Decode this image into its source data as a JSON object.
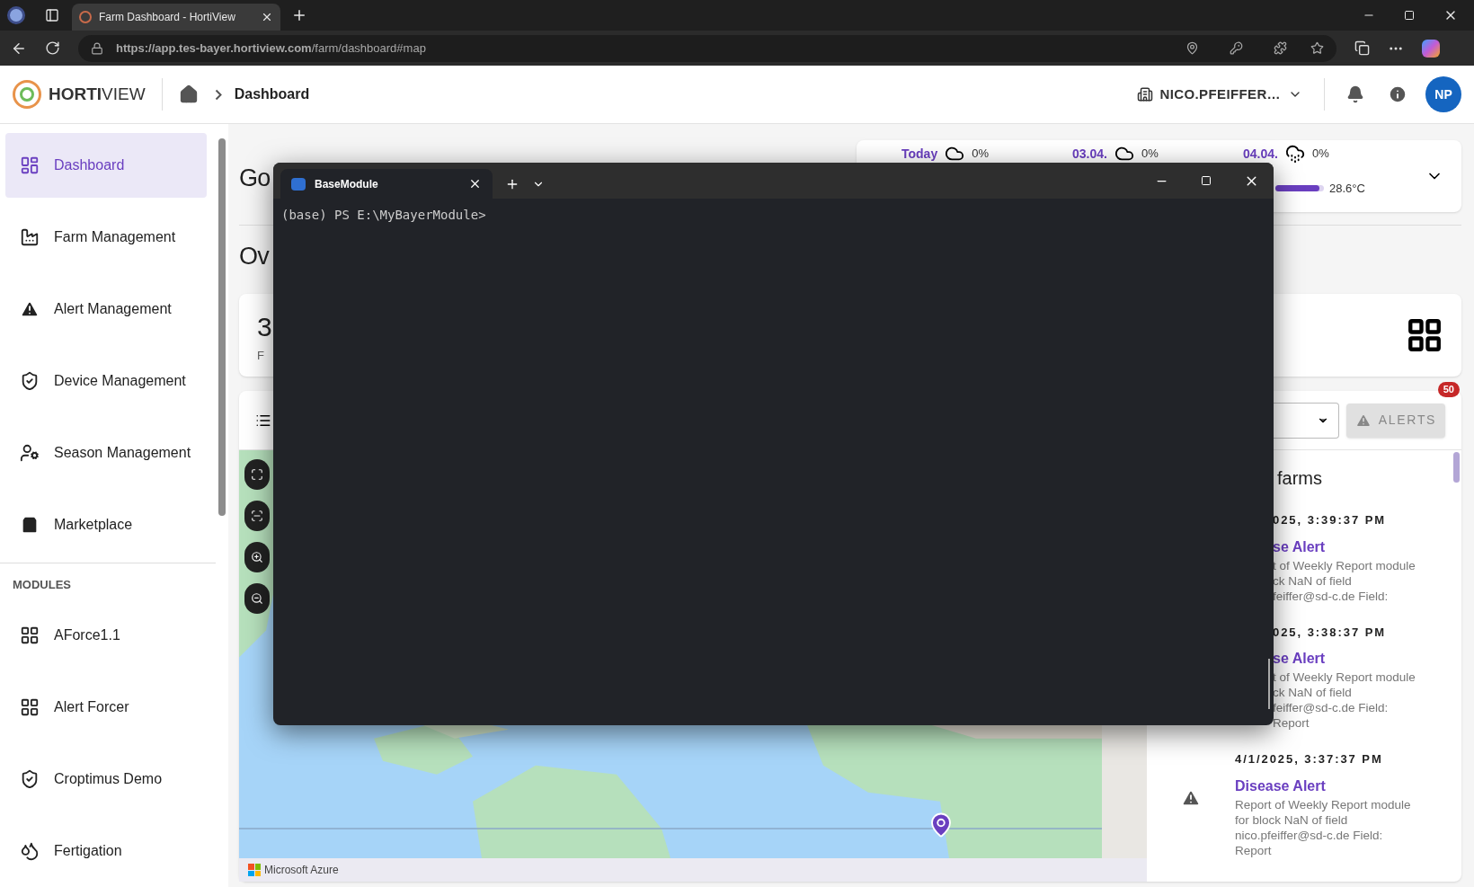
{
  "browser": {
    "tab_title": "Farm Dashboard - HortiView",
    "url": "**https://app.tes-bayer.hortiview.com**/farm/dashboard#map"
  },
  "app_header": {
    "logo": "**HORTI**VIEW",
    "breadcrumb": "Dashboard",
    "account": "NICO.PFEIFFER…",
    "avatar": "NP"
  },
  "sidebar": {
    "items": [
      {
        "label": "Dashboard",
        "selected": true
      },
      {
        "label": "Farm Management",
        "selected": false
      },
      {
        "label": "Alert Management",
        "selected": false
      },
      {
        "label": "Device Management",
        "selected": false
      },
      {
        "label": "Season Management",
        "selected": false
      },
      {
        "label": "Marketplace",
        "selected": false
      }
    ],
    "modules_heading": "MODULES",
    "modules": [
      {
        "label": "AForce1.1",
        "selected": false
      },
      {
        "label": "Alert Forcer",
        "selected": false
      },
      {
        "label": "Croptimus Demo",
        "selected": false
      },
      {
        "label": "Fertigation",
        "selected": false
      }
    ]
  },
  "main": {
    "greeting": "Go",
    "overview_heading": "Ov",
    "stat_value": "3",
    "stat_label": "F"
  },
  "weather": {
    "days": [
      {
        "label": "Today",
        "kind": "cloud",
        "precipitation": "0%"
      },
      {
        "label": "03.04.",
        "kind": "cloud",
        "precipitation": "0%"
      },
      {
        "label": "04.04.",
        "kind": "rain",
        "precipitation": "0%",
        "temperature": "28.6°C",
        "level": 0.9
      }
    ]
  },
  "map_panel": {
    "alerts_button": "ALERTS",
    "alerts_badge": "50",
    "attribution": "Microsoft Azure",
    "alerts_heading": "farms",
    "alerts": [
      {
        "kind": "cut",
        "time": "025, 3:39:37 PM",
        "title": "se Alert",
        "lines": [
          "t of Weekly Report module",
          "ck NaN of field",
          "feiffer@sd-c.de Field:"
        ]
      },
      {
        "kind": "cut",
        "time": "025, 3:38:37 PM",
        "title": "se Alert",
        "lines": [
          "t of Weekly Report module",
          "ck NaN of field",
          "feiffer@sd-c.de Field:",
          "Report"
        ]
      },
      {
        "kind": "whole",
        "time": "4/1/2025, 3:37:37 PM",
        "title": "Disease Alert",
        "lines": [
          "Report of Weekly Report module",
          "for block NaN of field",
          "nico.pfeiffer@sd-c.de Field:",
          "Report"
        ]
      }
    ]
  },
  "terminal": {
    "tab_title": "BaseModule",
    "prompt": "(base) PS E:\\MyBayerModule>"
  }
}
